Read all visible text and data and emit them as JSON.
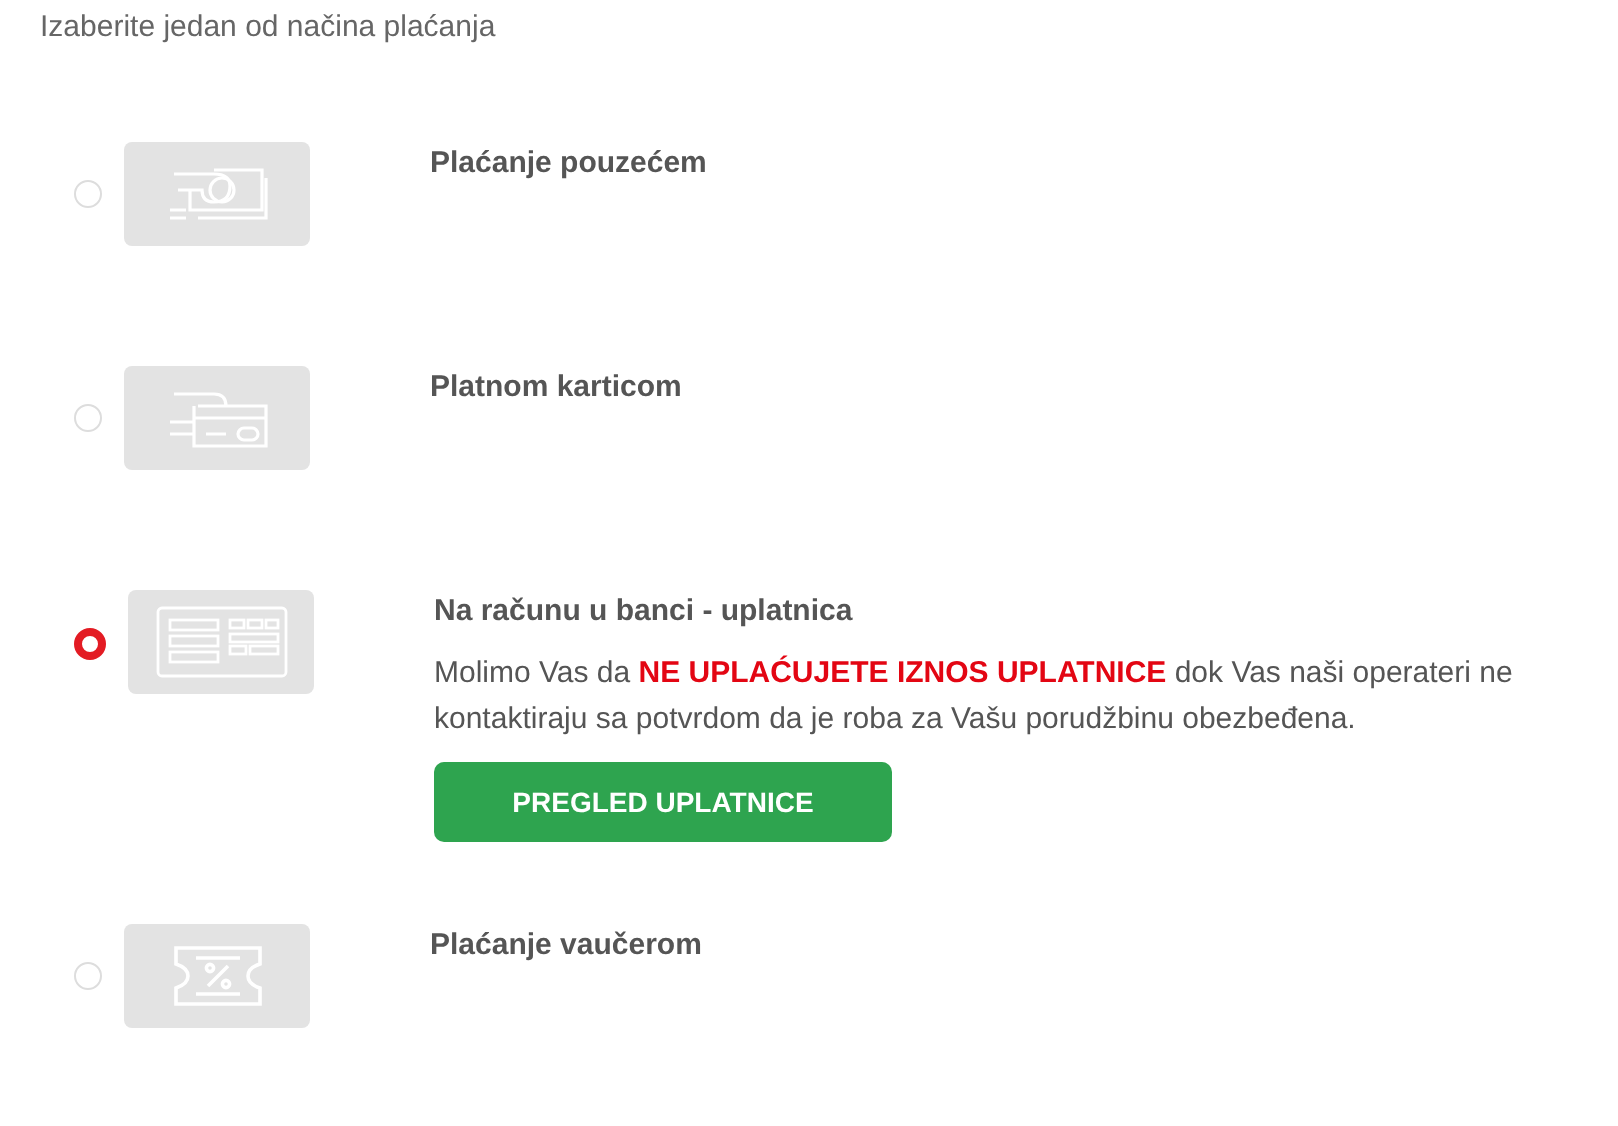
{
  "heading": "Izaberite jedan od načina plaćanja",
  "options": [
    {
      "kind": "cash",
      "label": "Plaćanje pouzećem",
      "selected": false
    },
    {
      "kind": "card",
      "label": "Platnom karticom",
      "selected": false
    },
    {
      "kind": "bank",
      "label": "Na računu u banci - uplatnica",
      "selected": true,
      "note": {
        "before": "Molimo Vas da ",
        "highlight": "NE UPLAĆUJETE IZNOS UPLATNICE",
        "after": " dok Vas naši operateri ne kontaktiraju sa potvrdom da je roba za Vašu porudžbinu obezbeđena."
      },
      "button": "PREGLED UPLATNICE"
    },
    {
      "kind": "voucher",
      "label": "Plaćanje vaučerom",
      "selected": false
    }
  ]
}
